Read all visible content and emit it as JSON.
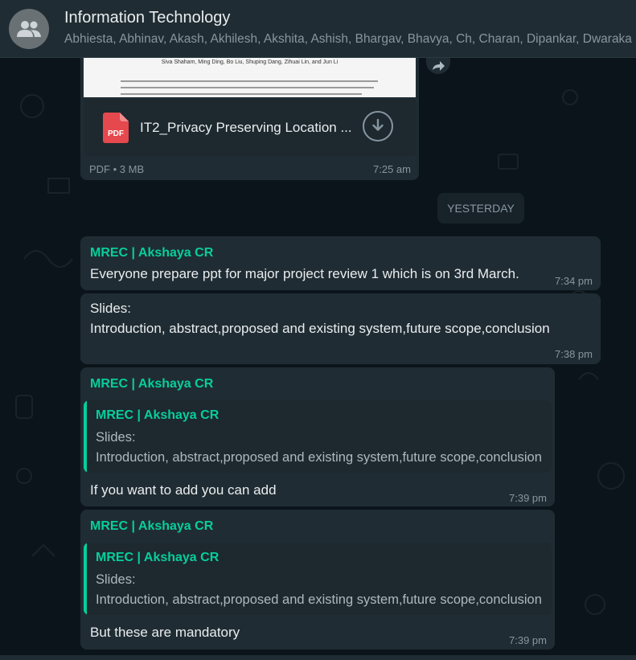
{
  "header": {
    "title": "Information Technology",
    "members": "Abhiesta, Abhinav, Akash, Akhilesh, Akshita, Ashish, Bhargav, Bhavya, Ch, Charan, Dipankar, Dwaraka"
  },
  "file_message": {
    "preview_authors": "Siva Shaham, Ming Ding, Bo Liu, Shuping Dang, Zihuai Lin, and Jun Li",
    "file_icon_label": "PDF",
    "file_name": "IT2_Privacy Preserving Location ...",
    "meta": "PDF • 3 MB",
    "time": "7:25 am"
  },
  "date_divider": "YESTERDAY",
  "messages": [
    {
      "sender": "MREC | Akshaya CR",
      "text": "Everyone prepare ppt for major project review 1 which is on 3rd March.",
      "time": "7:34 pm"
    },
    {
      "text_line1": "Slides:",
      "text_line2": "Introduction, abstract,proposed and existing system,future scope,conclusion",
      "time": "7:38 pm"
    },
    {
      "sender": "MREC | Akshaya CR",
      "quote": {
        "sender": "MREC | Akshaya CR",
        "line1": "Slides:",
        "line2": "Introduction, abstract,proposed and existing system,future scope,conclusion"
      },
      "text": "If you want to add you can add",
      "time": "7:39 pm"
    },
    {
      "sender": "MREC | Akshaya CR",
      "quote": {
        "sender": "MREC | Akshaya CR",
        "line1": "Slides:",
        "line2": "Introduction, abstract,proposed and existing system,future scope,conclusion"
      },
      "text": "But these are mandatory",
      "time": "7:39 pm"
    }
  ],
  "colors": {
    "background": "#0b141a",
    "header": "#202c33",
    "bubble": "#202c33",
    "accent": "#06cf9c",
    "text": "#e9edef",
    "muted": "#8696a0",
    "pdf_red": "#e5484d"
  },
  "icons": {
    "avatar": "group-icon",
    "forward": "forward-icon",
    "file": "pdf-file-icon",
    "download": "download-icon"
  }
}
